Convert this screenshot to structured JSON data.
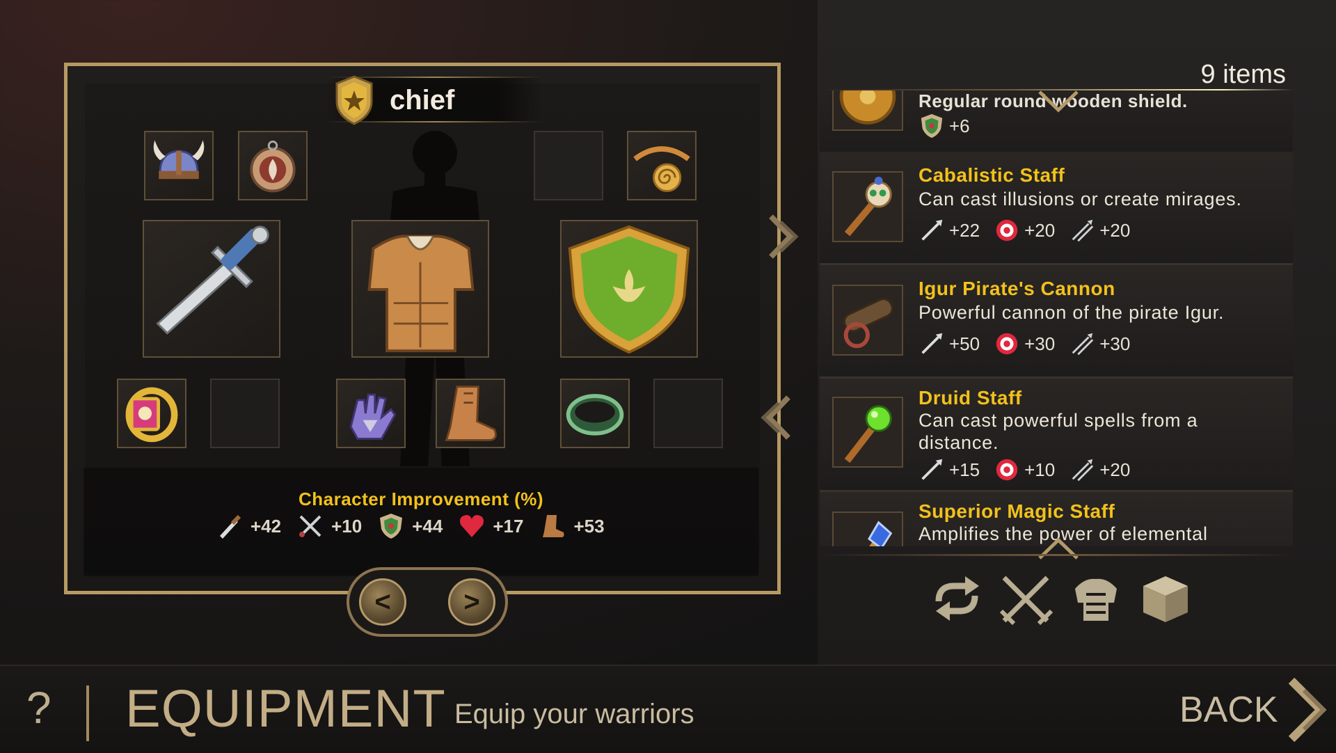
{
  "character": {
    "name": "chief",
    "rank_icon": "rank-star-shield-icon"
  },
  "equipment_slots": [
    {
      "slot": "helmet",
      "icon": "horned-helmet-icon"
    },
    {
      "slot": "amulet",
      "icon": "round-amulet-icon"
    },
    {
      "slot": "empty-top",
      "icon": ""
    },
    {
      "slot": "necklace",
      "icon": "spiral-necklace-icon"
    },
    {
      "slot": "weapon",
      "icon": "sword-icon"
    },
    {
      "slot": "armor",
      "icon": "leather-armor-icon"
    },
    {
      "slot": "shield",
      "icon": "green-shield-icon"
    },
    {
      "slot": "ring",
      "icon": "gold-ring-icon"
    },
    {
      "slot": "empty-left",
      "icon": ""
    },
    {
      "slot": "gloves",
      "icon": "gauntlet-icon"
    },
    {
      "slot": "boots",
      "icon": "boot-icon"
    },
    {
      "slot": "bracelet",
      "icon": "green-bracelet-icon"
    },
    {
      "slot": "empty-right",
      "icon": ""
    }
  ],
  "improvement": {
    "title": "Character Improvement (%)",
    "stats": [
      {
        "icon": "sword-stat-icon",
        "value": "+42"
      },
      {
        "icon": "crossed-swords-stat-icon",
        "value": "+10"
      },
      {
        "icon": "shield-stat-icon",
        "value": "+44"
      },
      {
        "icon": "heart-stat-icon",
        "value": "+17"
      },
      {
        "icon": "boot-stat-icon",
        "value": "+53"
      }
    ]
  },
  "nav": {
    "prev": "<",
    "next": ">"
  },
  "inventory": {
    "count_label": "9 items",
    "partial_top": {
      "name": "Regular round wooden shield.",
      "stat_value": "+6"
    },
    "items": [
      {
        "name": "Cabalistic Staff",
        "desc": "Can cast illusions or create mirages.",
        "stats": [
          "+22",
          "+20",
          "+20"
        ]
      },
      {
        "name": "Igur Pirate's Cannon",
        "desc": "Powerful cannon of the pirate Igur.",
        "stats": [
          "+50",
          "+30",
          "+30"
        ]
      },
      {
        "name": "Druid Staff",
        "desc": "Can cast powerful spells from a distance.",
        "stats": [
          "+15",
          "+10",
          "+20"
        ]
      },
      {
        "name": "Superior Magic Staff",
        "desc": "Amplifies the power of elemental"
      }
    ]
  },
  "filters": [
    {
      "icon": "cycle-arrows-icon"
    },
    {
      "icon": "crossed-swords-filter-icon"
    },
    {
      "icon": "armor-filter-icon"
    },
    {
      "icon": "box-filter-icon"
    }
  ],
  "footer": {
    "help": "?",
    "title": "EQUIPMENT",
    "subtitle": "Equip your warriors",
    "back": "BACK"
  },
  "colors": {
    "accent": "#f2c11c",
    "frame": "#b79a63"
  }
}
